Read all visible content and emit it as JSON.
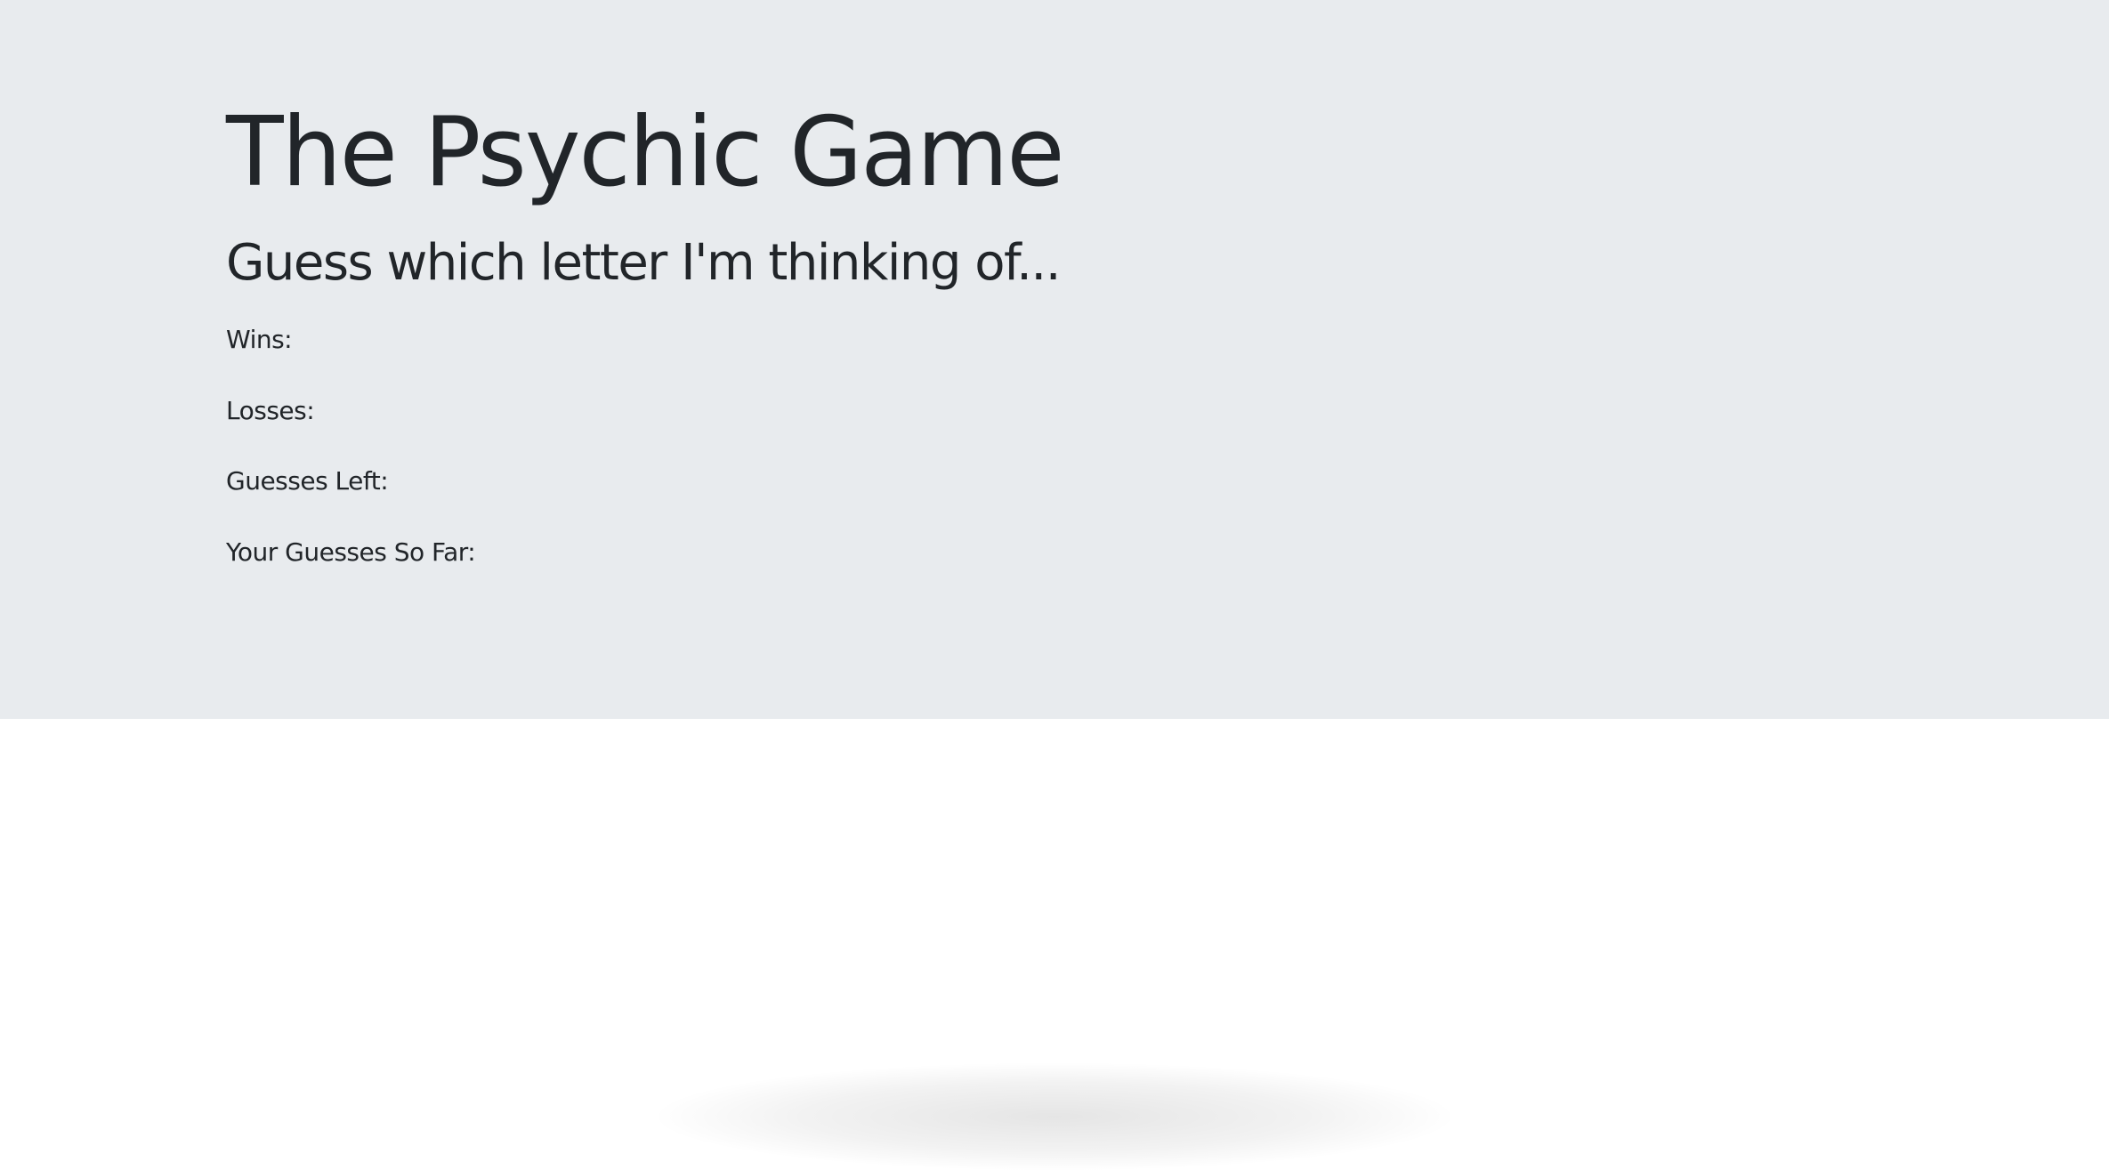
{
  "game": {
    "title": "The Psychic Game",
    "subtitle": "Guess which letter I'm thinking of...",
    "stats": {
      "wins_label": "Wins:",
      "wins_value": "",
      "losses_label": "Losses:",
      "losses_value": "",
      "guesses_left_label": "Guesses Left:",
      "guesses_left_value": "",
      "guesses_so_far_label": "Your Guesses So Far:",
      "guesses_so_far_value": ""
    }
  },
  "colors": {
    "jumbotron_background": "#e8ebee",
    "page_background": "#ffffff",
    "text": "#212529"
  }
}
